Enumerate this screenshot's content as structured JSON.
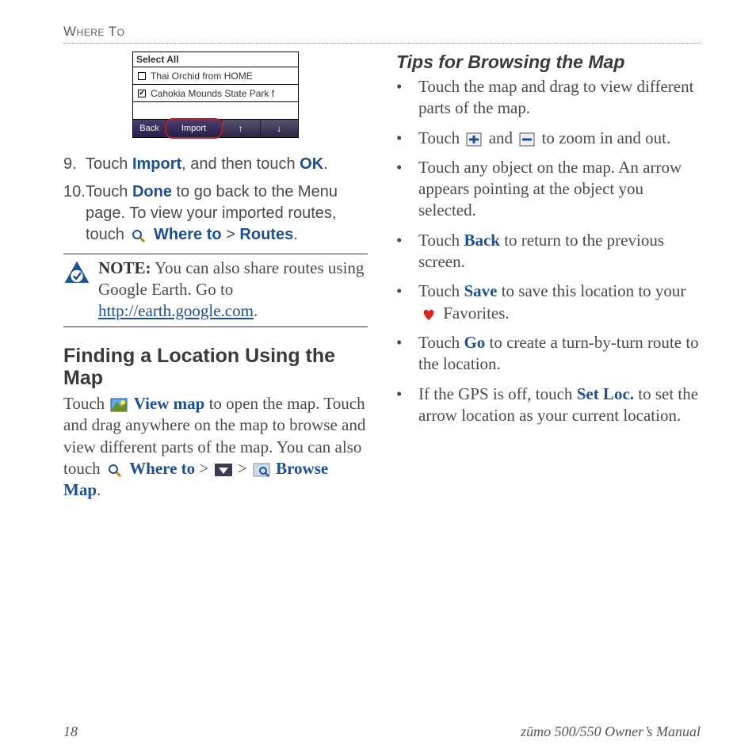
{
  "running_head": "Where To",
  "device": {
    "select_all": "Select All",
    "row1": "Thai Orchid from HOME",
    "row2": "Cahokia Mounds State Park f",
    "back": "Back",
    "import": "Import"
  },
  "steps": {
    "s9_num": "9.",
    "s9_a": "Touch ",
    "s9_import": "Import",
    "s9_b": ", and then touch ",
    "s9_ok": "OK",
    "s9_c": ".",
    "s10_num": "10.",
    "s10_a": "Touch ",
    "s10_done": "Done",
    "s10_b": " to go back to the Menu page. To view your imported routes, touch ",
    "s10_where": "Where to",
    "s10_gt": " > ",
    "s10_routes": "Routes",
    "s10_end": "."
  },
  "note": {
    "label": "NOTE:",
    "text_a": " You can also share routes using Google Earth. Go to ",
    "url": "http://earth.google.com",
    "text_b": "."
  },
  "section_heading": "Finding a Location Using the Map",
  "body": {
    "a": "Touch ",
    "viewmap": "View map",
    "b": " to open the map. Touch and drag anywhere on the map to browse and view different parts of the map. You can also touch ",
    "where": "Where to",
    "c": " > ",
    "d": " > ",
    "browse": "Browse Map",
    "e": "."
  },
  "tips_heading": "Tips for Browsing the Map",
  "tips": {
    "t1": "Touch the map and drag to view different parts of the map.",
    "t2a": "Touch ",
    "t2b": " and ",
    "t2c": " to zoom in and out.",
    "t3": "Touch any object on the map. An arrow appears pointing at the object you selected.",
    "t4a": "Touch ",
    "t4back": "Back",
    "t4b": " to return to the previous screen.",
    "t5a": "Touch ",
    "t5save": "Save",
    "t5b": " to save this location to your ",
    "t5c": " Favorites.",
    "t6a": "Touch ",
    "t6go": "Go",
    "t6b": " to create a turn-by-turn route to the location.",
    "t7a": "If the GPS is off, touch ",
    "t7set": "Set Loc.",
    "t7b": " to set the arrow location as your current location."
  },
  "footer": {
    "page": "18",
    "manual": "zūmo 500/550 Owner’s Manual"
  }
}
